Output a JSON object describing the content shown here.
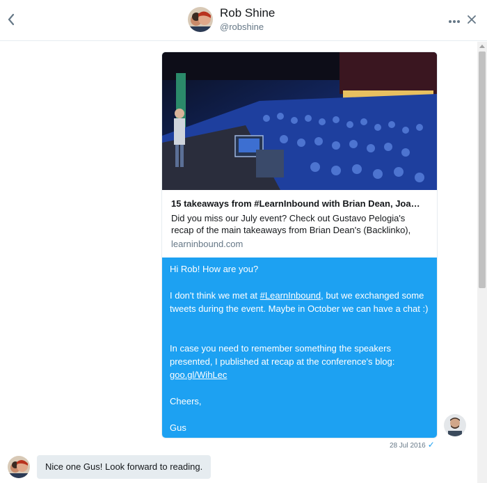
{
  "header": {
    "name": "Rob Shine",
    "handle": "@robshine",
    "back_icon": "chevron-left-icon",
    "more_icon": "more-dots-icon",
    "close_icon": "close-icon"
  },
  "link_preview": {
    "title": "15 takeaways from #LearnInbound with Brian Dean, Joa…",
    "description": "Did you miss our July event? Check out Gustavo Pelogia's recap of the main takeaways from Brian Dean's (Backlinko),",
    "domain": "learninbound.com"
  },
  "message": {
    "greeting": "Hi Rob! How are you?",
    "p1_before": "I don't think we met at ",
    "p1_hashtag": "#LearnInbound",
    "p1_after": ", but we exchanged some tweets during the event. Maybe in October we can have a chat :)",
    "p2": "In case you need to remember something the speakers presented, I published at recap at the conference's blog:",
    "p2_link": "goo.gl/WihLec",
    "signoff": "Cheers,",
    "name": "Gus",
    "timestamp": "28 Jul 2016",
    "status_icon": "checkmark-icon"
  },
  "reply": {
    "text": "Nice one Gus! Look forward to reading."
  },
  "colors": {
    "accent": "#1da1f2",
    "reply_bg": "#e6ecf0",
    "muted": "#657786"
  }
}
